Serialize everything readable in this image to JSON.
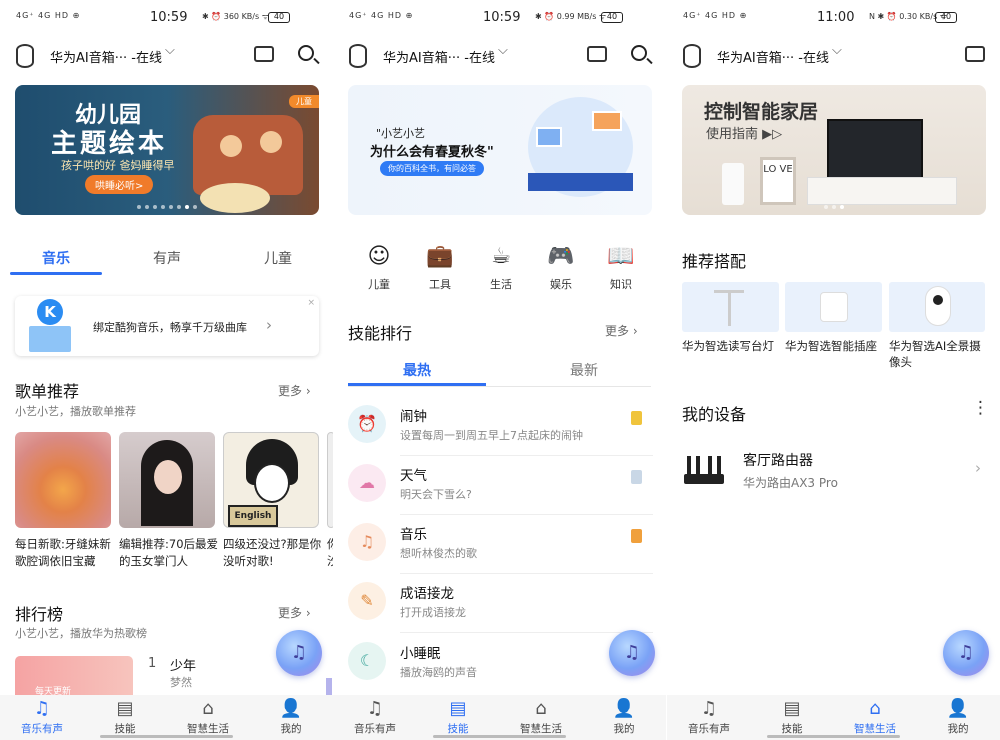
{
  "status": [
    {
      "left": "4G⁺ 4G HD ⊕",
      "time": "10:59",
      "right": "✱ ⏰ 360 KB/s ᯤ",
      "battery": "40"
    },
    {
      "left": "4G⁺ 4G HD ⊕",
      "time": "10:59",
      "right": "✱ ⏰ 0.99 MB/s ᯤ",
      "battery": "40"
    },
    {
      "left": "4G⁺ 4G HD ⊕",
      "time": "11:00",
      "right": "N ✱ ⏰ 0.30 KB/s ᯤ",
      "battery": "40"
    }
  ],
  "header": {
    "device": "华为AI音箱··· -在线",
    "chevron": "⌵"
  },
  "p1": {
    "banner": {
      "t1": "幼儿园",
      "t2": "主题绘本",
      "t3": "孩子哄的好 爸妈睡得早",
      "btn": "哄睡必听>",
      "tag": "儿童"
    },
    "tabs": [
      "音乐",
      "有声",
      "儿童"
    ],
    "kugou": {
      "logo": "K",
      "text": "绑定酷狗音乐，畅享千万级曲库",
      "arrow": "›",
      "close": "×"
    },
    "playlist": {
      "title": "歌单推荐",
      "sub": "小艺小艺，播放歌单推荐",
      "more": "更多 ›",
      "cards": [
        {
          "caption": "每日新歌:牙缝妹新歌腔调依旧宝藏"
        },
        {
          "caption": "编辑推荐:70后最爱的玉女掌门人"
        },
        {
          "caption": "四级还没过?那是你没听对歌!",
          "book": "English"
        },
        {
          "caption": "你 汐"
        }
      ]
    },
    "rank": {
      "title": "排行榜",
      "sub": "小艺小艺，播放华为热歌榜",
      "more": "更多 ›",
      "img_label": "每天更新",
      "num": "1",
      "song": "少年",
      "artist": "梦然"
    }
  },
  "p2": {
    "banner": {
      "t1": "\"小艺小艺",
      "t2": "为什么会有春夏秋冬\"",
      "pill": "你的百科全书，有问必答"
    },
    "cats": [
      {
        "icon": "☺",
        "label": "儿童"
      },
      {
        "icon": "💼",
        "label": "工具"
      },
      {
        "icon": "☕",
        "label": "生活"
      },
      {
        "icon": "🎮",
        "label": "娱乐"
      },
      {
        "icon": "📖",
        "label": "知识"
      }
    ],
    "skills": {
      "title": "技能排行",
      "more": "更多 ›",
      "tabs": [
        "最热",
        "最新"
      ],
      "rows": [
        {
          "icon": "⏰",
          "title": "闹钟",
          "desc": "设置每周一到周五早上7点起床的闹钟",
          "bg": "#e5f3f8",
          "fg": "#3aa7c7",
          "badge": "#f0c43c"
        },
        {
          "icon": "☁",
          "title": "天气",
          "desc": "明天会下雪么?",
          "bg": "#fbe9f2",
          "fg": "#e178a8",
          "badge": "#c9d7e6"
        },
        {
          "icon": "♫",
          "title": "音乐",
          "desc": "想听林俊杰的歌",
          "bg": "#fdeee6",
          "fg": "#e58b5d",
          "badge": "#f0a03c"
        },
        {
          "icon": "✎",
          "title": "成语接龙",
          "desc": "打开成语接龙",
          "bg": "#fdf0e3",
          "fg": "#e0893b",
          "badge": ""
        },
        {
          "icon": "☾",
          "title": "小睡眠",
          "desc": "播放海鸥的声音",
          "bg": "#e6f5f2",
          "fg": "#3ba59a",
          "badge": ""
        }
      ]
    }
  },
  "p3": {
    "banner": {
      "t1": "控制智能家居",
      "t2": "使用指南 ▶▷",
      "frame": "LO VE"
    },
    "rec": {
      "title": "推荐搭配",
      "items": [
        "华为智选读写台灯",
        "华为智选智能插座",
        "华为智选AI全景摄像头"
      ]
    },
    "devices": {
      "title": "我的设备",
      "menu": "⋮",
      "name": "客厅路由器",
      "model": "华为路由AX3 Pro",
      "arrow": "›"
    }
  },
  "float_icon": "♫",
  "nav": [
    {
      "icon": "♫",
      "label": "音乐有声"
    },
    {
      "icon": "▤",
      "label": "技能"
    },
    {
      "icon": "⌂",
      "label": "智慧生活"
    },
    {
      "icon": "👤",
      "label": "我的"
    }
  ],
  "accent": "#2f6ff2"
}
